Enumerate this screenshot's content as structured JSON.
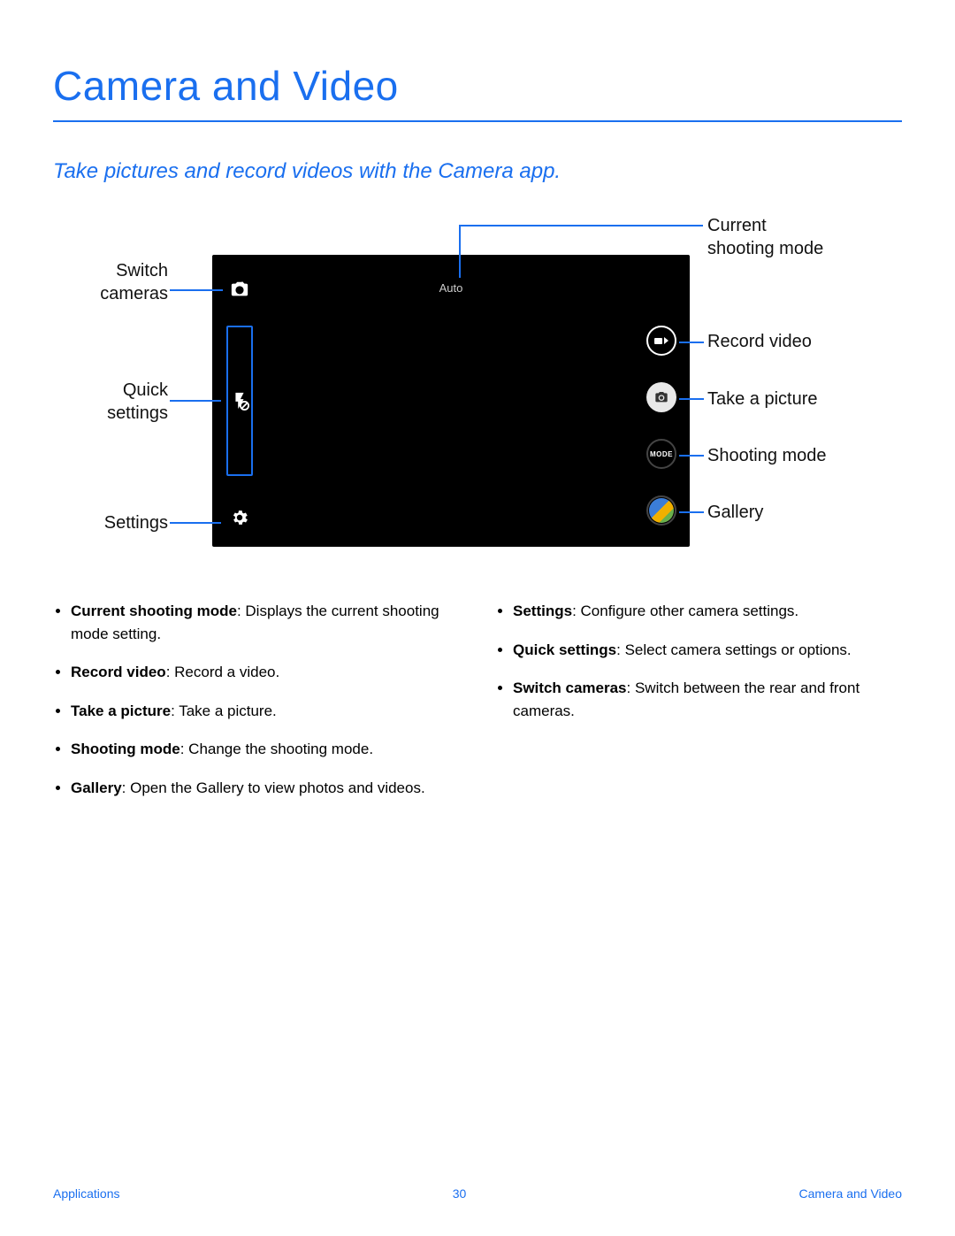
{
  "title": "Camera and Video",
  "subtitle": "Take pictures and record videos with the Camera app.",
  "screenshot": {
    "mode_label": "Auto",
    "mode_button": "MODE"
  },
  "callouts": {
    "switch_cameras": "Switch\ncameras",
    "quick_settings": "Quick\nsettings",
    "settings": "Settings",
    "current_mode": "Current\nshooting mode",
    "record_video": "Record video",
    "take_picture": "Take a picture",
    "shooting_mode": "Shooting mode",
    "gallery": "Gallery"
  },
  "bullets": {
    "left": [
      {
        "term": "Current shooting mode",
        "desc": ": Displays the current shooting mode setting."
      },
      {
        "term": "Record video",
        "desc": ": Record a video."
      },
      {
        "term": "Take a picture",
        "desc": ": Take a picture."
      },
      {
        "term": "Shooting mode",
        "desc": ": Change the shooting mode."
      },
      {
        "term": "Gallery",
        "desc": ": Open the Gallery to view photos and videos."
      }
    ],
    "right": [
      {
        "term": "Settings",
        "desc": ": Configure other camera settings."
      },
      {
        "term": "Quick settings",
        "desc": ": Select camera settings or options."
      },
      {
        "term": "Switch cameras",
        "desc": ": Switch between the rear and front cameras."
      }
    ]
  },
  "footer": {
    "left": "Applications",
    "center": "30",
    "right": "Camera and Video"
  }
}
